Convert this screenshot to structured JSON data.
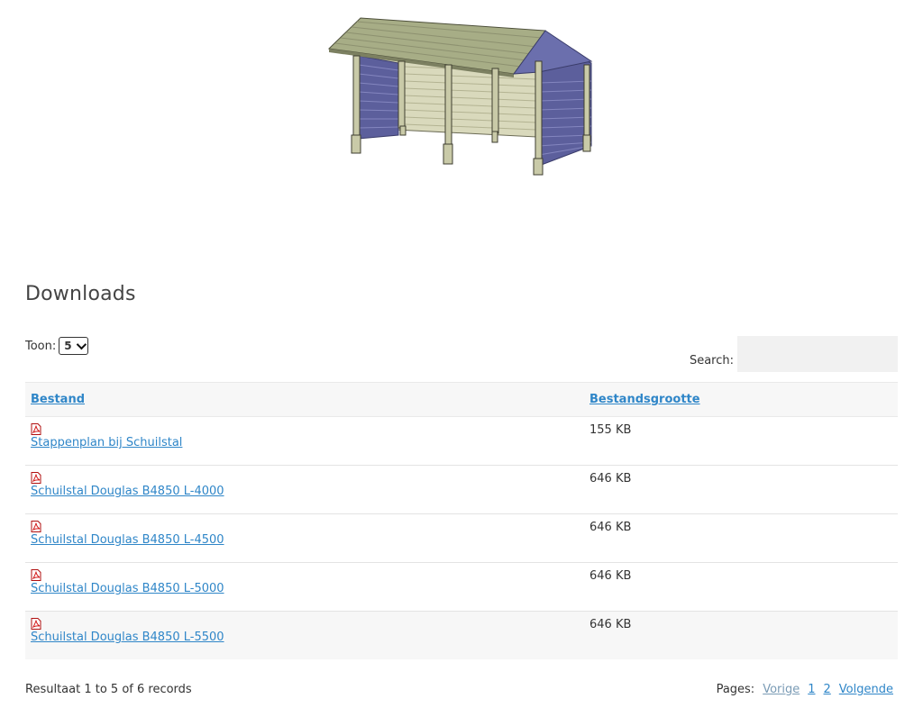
{
  "section": {
    "title": "Downloads"
  },
  "controls": {
    "toon_label": "Toon:",
    "toon_value": "5",
    "search_label": "Search:",
    "search_value": ""
  },
  "table": {
    "headers": [
      "Bestand",
      "Bestandsgrootte"
    ],
    "rows": [
      {
        "name": "Stappenplan bij Schuilstal",
        "size": "155 KB",
        "icon": "pdf-icon"
      },
      {
        "name": "Schuilstal Douglas B4850 L-4000",
        "size": "646 KB",
        "icon": "pdf-icon"
      },
      {
        "name": "Schuilstal Douglas B4850 L-4500",
        "size": "646 KB",
        "icon": "pdf-icon"
      },
      {
        "name": "Schuilstal Douglas B4850 L-5000",
        "size": "646 KB",
        "icon": "pdf-icon"
      },
      {
        "name": "Schuilstal Douglas B4850 L-5500",
        "size": "646 KB",
        "icon": "pdf-icon"
      }
    ]
  },
  "footer": {
    "result_text": "Resultaat 1 to 5 of 6 records",
    "pages_label": "Pages:",
    "prev_label": "Vorige",
    "page_1": "1",
    "page_2": "2",
    "next_label": "Volgende"
  },
  "colors": {
    "link": "#2f86c8",
    "roof": "#a7ad86",
    "wall_side": "#5c5f9c",
    "post": "#c9caa8"
  }
}
